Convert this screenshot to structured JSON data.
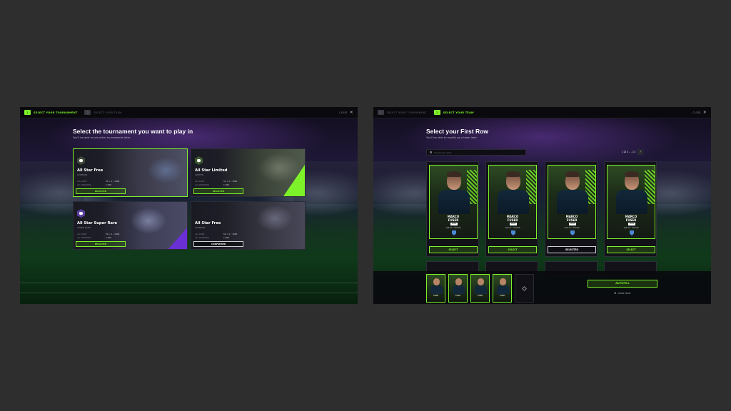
{
  "left": {
    "steps": [
      {
        "num": "1",
        "label": "SELECT YOUR TOURNAMENT",
        "state": "active"
      },
      {
        "num": "2",
        "label": "SELECT YOUR TEAM",
        "state": "inactive"
      }
    ],
    "close_label": "CLOSE",
    "title": "Select the tournament you want to play in",
    "subtitle": "You'll be able to join other tournaments later",
    "tournaments": [
      {
        "name": "All Star Free",
        "tier": "COMMON",
        "meta1": "ALL RARE",
        "meta2": "ALL REWARDS",
        "stats1": "50  •  4  •  1000",
        "stats2": "1 000",
        "button": "REGISTER",
        "selected": true,
        "wedge": "#7df12a"
      },
      {
        "name": "All Star Limited",
        "tier": "LIMITED",
        "meta1": "ALL RARE",
        "meta2": "ALL REWARDS",
        "stats1": "50  •  4  •  1000",
        "stats2": "1 000",
        "button": "REGISTER",
        "selected": false,
        "wedge": "#7df12a"
      },
      {
        "name": "All Star Super Rare",
        "tier": "SUPER RARE",
        "meta1": "ALL RARE",
        "meta2": "ALL REWARDS",
        "stats1": "50  •  4  •  1000",
        "stats2": "1 000",
        "button": "REGISTER",
        "selected": false,
        "wedge": "#6b2fd6"
      },
      {
        "name": "All Star Free",
        "tier": "COMMON",
        "meta1": "ALL RARE",
        "meta2": "ALL REWARDS",
        "stats1": "50  •  4  •  1000",
        "stats2": "1 000",
        "button": "CONFIRMED",
        "selected": false,
        "wedge": "#2a2a36"
      }
    ]
  },
  "right": {
    "steps": [
      {
        "num": "1",
        "label": "SELECT YOUR TOURNAMENT",
        "state": "inactive"
      },
      {
        "num": "2",
        "label": "SELECT YOUR TEAM",
        "state": "active"
      }
    ],
    "close_label": "CLOSE",
    "title": "Select your First Row",
    "subtitle": "You'll be able to modify your team later",
    "search_placeholder": "Search by name",
    "pager": {
      "pages": "1",
      "current": "2",
      "more": "3 ... 14",
      "next": "14"
    },
    "players": [
      {
        "name_line1": "MARCO",
        "name_line2": "FUSER",
        "position": "LOCK",
        "info": "AGE 32  •  ITALIAN",
        "club": "BENETTON RUGBY",
        "button": "SELECT",
        "state": "select"
      },
      {
        "name_line1": "MARCO",
        "name_line2": "FUSER",
        "position": "LOCK",
        "info": "AGE 32  •  ITALIAN",
        "club": "BENETTON RUGBY",
        "button": "SELECT",
        "state": "select"
      },
      {
        "name_line1": "MARCO",
        "name_line2": "FUSER",
        "position": "LOCK",
        "info": "AGE 32  •  ITALIAN",
        "club": "BENETTON RUGBY",
        "button": "SELECTED",
        "state": "selected"
      },
      {
        "name_line1": "MARCO",
        "name_line2": "FUSER",
        "position": "LOCK",
        "info": "AGE 32  •  ITALIAN",
        "club": "BENETTON RUGBY",
        "button": "SELECT",
        "state": "select"
      }
    ],
    "tray": [
      {
        "label": "FUSER"
      },
      {
        "label": "FUSER"
      },
      {
        "label": "FUSER"
      },
      {
        "label": "FUSER"
      }
    ],
    "autofill_label": "AUTOFILL",
    "clear_label": "CLEAR TEAM"
  },
  "colors": {
    "accent": "#7df12a",
    "background": "#2e2e2e",
    "purple": "#6b2fd6"
  }
}
